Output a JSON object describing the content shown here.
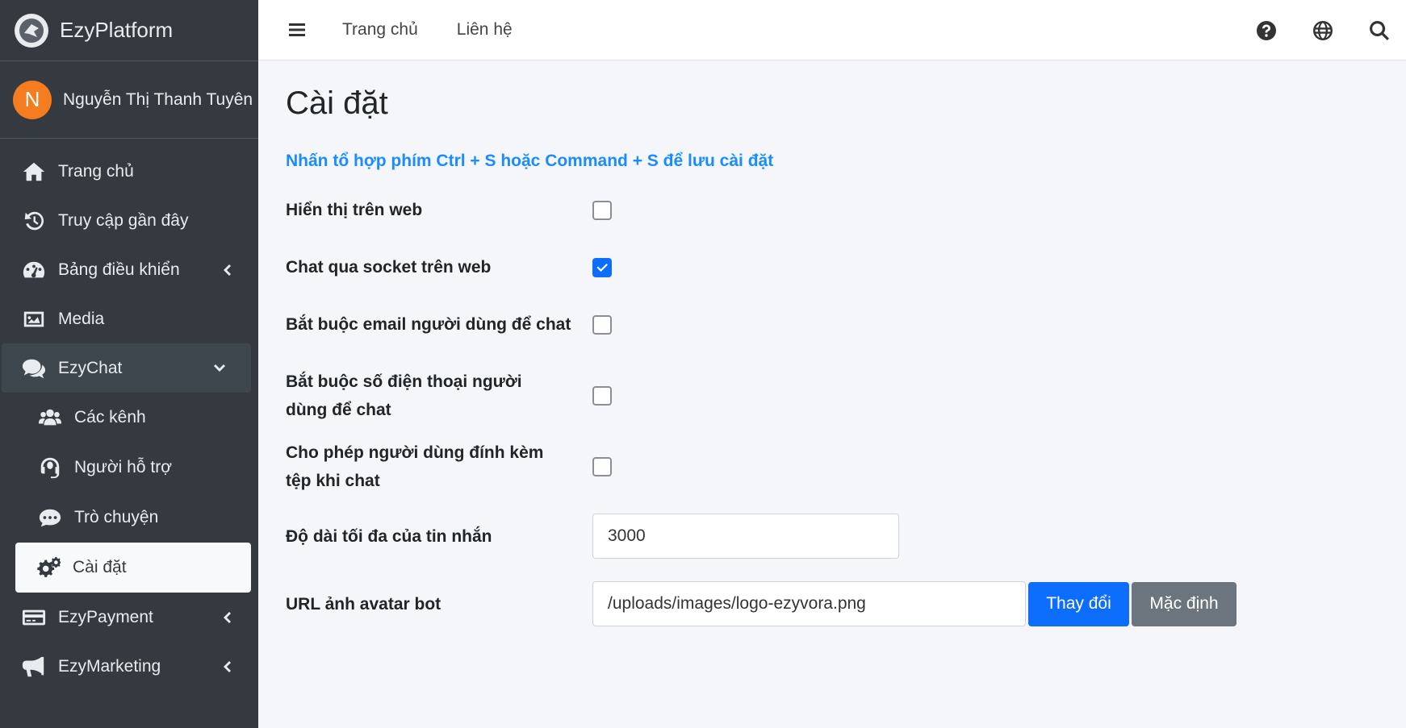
{
  "brand": {
    "name": "EzyPlatform"
  },
  "user": {
    "initial": "N",
    "name": "Nguyễn Thị Thanh Tuyên"
  },
  "sidebar": {
    "items": [
      {
        "label": "Trang chủ",
        "icon": "home-icon"
      },
      {
        "label": "Truy cập gần đây",
        "icon": "history-icon"
      },
      {
        "label": "Bảng điều khiển",
        "icon": "dashboard-icon"
      },
      {
        "label": "Media",
        "icon": "image-icon"
      },
      {
        "label": "EzyChat",
        "icon": "chat-icon"
      },
      {
        "label": "Các kênh",
        "icon": "users-icon"
      },
      {
        "label": "Người hỗ trợ",
        "icon": "headset-icon"
      },
      {
        "label": "Trò chuyện",
        "icon": "comment-icon"
      },
      {
        "label": "Cài đặt",
        "icon": "gears-icon"
      },
      {
        "label": "EzyPayment",
        "icon": "credit-card-icon"
      },
      {
        "label": "EzyMarketing",
        "icon": "megaphone-icon"
      }
    ]
  },
  "topbar": {
    "links": [
      "Trang chủ",
      "Liên hệ"
    ]
  },
  "page": {
    "title": "Cài đặt",
    "hint": "Nhấn tổ hợp phím Ctrl + S hoặc Command + S để lưu cài đặt"
  },
  "settings": [
    {
      "label": "Hiển thị trên web",
      "checked": false
    },
    {
      "label": "Chat qua socket trên web",
      "checked": true
    },
    {
      "label": "Bắt buộc email người dùng để chat",
      "checked": false
    },
    {
      "label": "Bắt buộc số điện thoại người dùng để chat",
      "checked": false
    },
    {
      "label": "Cho phép người dùng đính kèm tệp khi chat",
      "checked": false
    }
  ],
  "max_length": {
    "label": "Độ dài tối đa của tin nhắn",
    "value": "3000"
  },
  "avatar_url": {
    "label": "URL ảnh avatar bot",
    "value": "/uploads/images/logo-ezyvora.png",
    "change_label": "Thay đổi",
    "default_label": "Mặc định"
  },
  "colors": {
    "primary": "#0d6efd",
    "hint": "#1a8cff",
    "sidebar": "#343a40",
    "avatar": "#f57c1f"
  }
}
